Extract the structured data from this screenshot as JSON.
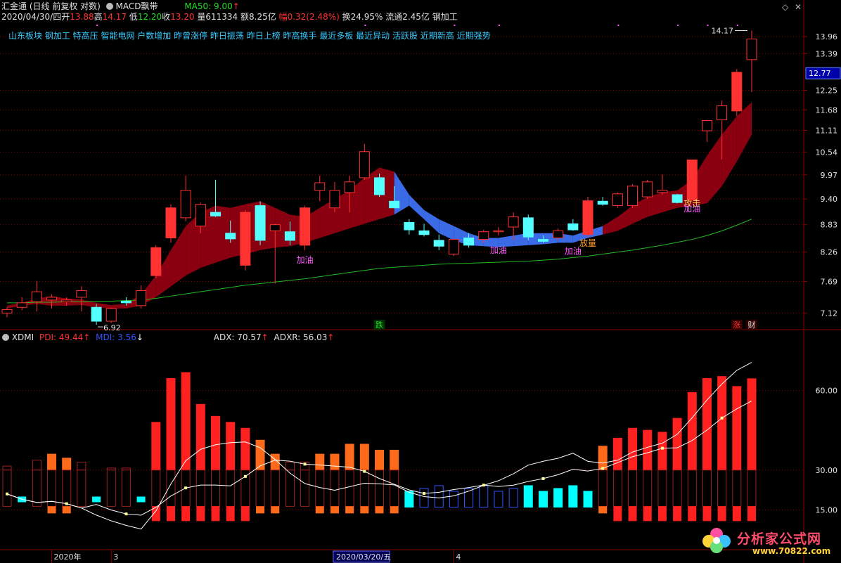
{
  "header": {
    "app": "汇金通",
    "mode": "(日线 前复权 对数)",
    "indicator": "MACD飘带",
    "ma_label": "MA50: 9.00",
    "date": "2020/04/30/四",
    "open_label": "开",
    "open": "13.88",
    "high_label": "高",
    "high": "14.17",
    "low_label": "低",
    "low": "12.20",
    "close_label": "收",
    "close": "13.20",
    "volume": "量611334",
    "amount": "额8.25亿",
    "change": "幅0.32(2.48%)",
    "turnover": "换24.95%",
    "float": "流通2.45亿",
    "industry": "钢加工"
  },
  "concepts": "山东板块 钢加工 特高压 智能电网 户数增加 昨曾涨停 昨日振荡 昨日上榜 昨高换手 最近多板 最近异动 活跃股 近期新高 近期强势",
  "sub_header": {
    "name": "XDMI",
    "pdi": "PDI: 49.44",
    "mdi": "MDI: 3.56",
    "adx": "ADX: 70.57",
    "adxr": "ADXR: 56.03"
  },
  "price_axis": [
    "13.96",
    "13.39",
    "12.25",
    "11.68",
    "11.11",
    "10.54",
    "9.97",
    "9.40",
    "8.83",
    "8.26",
    "7.69",
    "7.12"
  ],
  "current_price_tag": "12.77",
  "sub_axis": [
    "60.00",
    "30.00",
    "15.00"
  ],
  "x_axis_labels": [
    "2020年",
    "3",
    "2020/03/20/五",
    "4"
  ],
  "colors": {
    "up": "#ff3232",
    "down": "#54ffff",
    "ribbon_up": "#8b0011",
    "ribbon_down": "#3a6ae6",
    "ma": "#22bb22",
    "grid": "#8b0000",
    "magenta": "#ff55ff",
    "label": "#ff9f2a"
  },
  "chart_data": [
    {
      "type": "candlestick",
      "title": "MACD飘带",
      "scale": "log",
      "ylim": [
        6.85,
        14.5
      ],
      "high_mark": "14.17",
      "low_mark": "6.92",
      "candles": [
        {
          "o": 7.12,
          "h": 7.22,
          "l": 7.05,
          "c": 7.18
        },
        {
          "o": 7.22,
          "h": 7.4,
          "l": 7.17,
          "c": 7.3
        },
        {
          "o": 7.32,
          "h": 7.7,
          "l": 7.15,
          "c": 7.5
        },
        {
          "o": 7.35,
          "h": 7.45,
          "l": 7.2,
          "c": 7.4
        },
        {
          "o": 7.32,
          "h": 7.4,
          "l": 7.25,
          "c": 7.35
        },
        {
          "o": 7.4,
          "h": 7.6,
          "l": 7.15,
          "c": 7.52
        },
        {
          "o": 7.22,
          "h": 7.28,
          "l": 6.92,
          "c": 6.98
        },
        {
          "o": 6.98,
          "h": 7.22,
          "l": 6.95,
          "c": 7.2
        },
        {
          "o": 7.33,
          "h": 7.4,
          "l": 7.25,
          "c": 7.3
        },
        {
          "o": 7.25,
          "h": 7.62,
          "l": 7.2,
          "c": 7.52
        },
        {
          "o": 7.8,
          "h": 8.4,
          "l": 7.75,
          "c": 8.35
        },
        {
          "o": 8.55,
          "h": 9.28,
          "l": 8.45,
          "c": 9.2
        },
        {
          "o": 8.98,
          "h": 9.95,
          "l": 8.9,
          "c": 9.6
        },
        {
          "o": 8.8,
          "h": 9.32,
          "l": 8.65,
          "c": 9.28
        },
        {
          "o": 9.1,
          "h": 9.85,
          "l": 9.0,
          "c": 9.02
        },
        {
          "o": 8.65,
          "h": 8.92,
          "l": 8.45,
          "c": 8.53
        },
        {
          "o": 8.0,
          "h": 9.15,
          "l": 7.9,
          "c": 9.1
        },
        {
          "o": 9.25,
          "h": 9.35,
          "l": 8.4,
          "c": 8.5
        },
        {
          "o": 8.7,
          "h": 8.85,
          "l": 7.65,
          "c": 8.83
        },
        {
          "o": 8.68,
          "h": 8.9,
          "l": 8.4,
          "c": 8.5
        },
        {
          "o": 8.4,
          "h": 9.25,
          "l": 8.3,
          "c": 9.2
        },
        {
          "o": 9.6,
          "h": 9.95,
          "l": 9.35,
          "c": 9.78
        },
        {
          "o": 9.2,
          "h": 9.8,
          "l": 9.1,
          "c": 9.6
        },
        {
          "o": 9.55,
          "h": 9.95,
          "l": 9.1,
          "c": 9.8
        },
        {
          "o": 9.9,
          "h": 10.75,
          "l": 9.85,
          "c": 10.55
        },
        {
          "o": 9.9,
          "h": 10.0,
          "l": 9.45,
          "c": 9.5
        },
        {
          "o": 9.35,
          "h": 9.7,
          "l": 9.2,
          "c": 9.2
        },
        {
          "o": 8.88,
          "h": 8.95,
          "l": 8.62,
          "c": 8.72
        },
        {
          "o": 8.7,
          "h": 8.85,
          "l": 8.58,
          "c": 8.62
        },
        {
          "o": 8.5,
          "h": 8.62,
          "l": 8.3,
          "c": 8.38
        },
        {
          "o": 8.22,
          "h": 8.55,
          "l": 8.18,
          "c": 8.52
        },
        {
          "o": 8.55,
          "h": 8.65,
          "l": 8.35,
          "c": 8.4
        },
        {
          "o": 8.52,
          "h": 8.72,
          "l": 8.45,
          "c": 8.68
        },
        {
          "o": 8.68,
          "h": 8.78,
          "l": 8.6,
          "c": 8.7
        },
        {
          "o": 8.78,
          "h": 9.1,
          "l": 8.5,
          "c": 9.0
        },
        {
          "o": 8.98,
          "h": 9.05,
          "l": 8.5,
          "c": 8.57
        },
        {
          "o": 8.52,
          "h": 8.6,
          "l": 8.45,
          "c": 8.48
        },
        {
          "o": 8.55,
          "h": 8.75,
          "l": 8.5,
          "c": 8.7
        },
        {
          "o": 8.85,
          "h": 8.95,
          "l": 8.7,
          "c": 8.72
        },
        {
          "o": 8.62,
          "h": 9.45,
          "l": 8.55,
          "c": 9.36
        },
        {
          "o": 9.35,
          "h": 9.45,
          "l": 9.25,
          "c": 9.28
        },
        {
          "o": 9.25,
          "h": 9.55,
          "l": 9.2,
          "c": 9.52
        },
        {
          "o": 9.25,
          "h": 9.75,
          "l": 9.2,
          "c": 9.7
        },
        {
          "o": 9.45,
          "h": 9.85,
          "l": 9.4,
          "c": 9.8
        },
        {
          "o": 9.55,
          "h": 9.98,
          "l": 9.5,
          "c": 9.6
        },
        {
          "o": 9.5,
          "h": 9.52,
          "l": 9.3,
          "c": 9.32
        },
        {
          "o": 9.38,
          "h": 10.34,
          "l": 9.36,
          "c": 10.34
        },
        {
          "o": 11.1,
          "h": 11.38,
          "l": 10.8,
          "c": 11.38
        },
        {
          "o": 11.4,
          "h": 11.95,
          "l": 10.35,
          "c": 11.8
        },
        {
          "o": 11.65,
          "h": 12.9,
          "l": 11.5,
          "c": 12.8
        },
        {
          "o": 13.2,
          "h": 14.17,
          "l": 12.2,
          "c": 13.88
        }
      ],
      "ribbon": [
        {
          "a": 7.2,
          "b": 7.25
        },
        {
          "a": 7.25,
          "b": 7.3
        },
        {
          "a": 7.28,
          "b": 7.38
        },
        {
          "a": 7.25,
          "b": 7.42
        },
        {
          "a": 7.25,
          "b": 7.38
        },
        {
          "a": 7.26,
          "b": 7.36
        },
        {
          "a": 7.22,
          "b": 7.3
        },
        {
          "a": 7.2,
          "b": 7.26
        },
        {
          "a": 7.2,
          "b": 7.28
        },
        {
          "a": 7.25,
          "b": 7.45
        },
        {
          "a": 7.4,
          "b": 7.8
        },
        {
          "a": 7.6,
          "b": 8.3
        },
        {
          "a": 7.8,
          "b": 8.8
        },
        {
          "a": 7.95,
          "b": 9.1
        },
        {
          "a": 8.05,
          "b": 9.25
        },
        {
          "a": 8.15,
          "b": 9.2
        },
        {
          "a": 8.22,
          "b": 9.28
        },
        {
          "a": 8.3,
          "b": 9.35
        },
        {
          "a": 8.35,
          "b": 9.2
        },
        {
          "a": 8.38,
          "b": 9.05
        },
        {
          "a": 8.45,
          "b": 9.0
        },
        {
          "a": 8.55,
          "b": 9.2
        },
        {
          "a": 8.65,
          "b": 9.4
        },
        {
          "a": 8.75,
          "b": 9.6
        },
        {
          "a": 8.85,
          "b": 9.9
        },
        {
          "a": 8.95,
          "b": 10.15
        },
        {
          "a": 9.05,
          "b": 10.05
        },
        {
          "a": 9.25,
          "b": 9.5
        },
        {
          "a": 8.95,
          "b": 9.15
        },
        {
          "a": 8.65,
          "b": 8.95
        },
        {
          "a": 8.5,
          "b": 8.8
        },
        {
          "a": 8.4,
          "b": 8.65
        },
        {
          "a": 8.38,
          "b": 8.55
        },
        {
          "a": 8.36,
          "b": 8.55
        },
        {
          "a": 8.38,
          "b": 8.6
        },
        {
          "a": 8.4,
          "b": 8.65
        },
        {
          "a": 8.42,
          "b": 8.65
        },
        {
          "a": 8.45,
          "b": 8.65
        },
        {
          "a": 8.45,
          "b": 8.6
        },
        {
          "a": 8.55,
          "b": 8.7
        },
        {
          "a": 8.62,
          "b": 8.8
        },
        {
          "a": 8.7,
          "b": 9.0
        },
        {
          "a": 8.85,
          "b": 9.25
        },
        {
          "a": 9.0,
          "b": 9.45
        },
        {
          "a": 9.1,
          "b": 9.55
        },
        {
          "a": 9.2,
          "b": 9.6
        },
        {
          "a": 9.25,
          "b": 9.85
        },
        {
          "a": 9.3,
          "b": 10.45
        },
        {
          "a": 9.7,
          "b": 11.0
        },
        {
          "a": 10.3,
          "b": 11.5
        },
        {
          "a": 11.0,
          "b": 11.9
        }
      ],
      "ma50": [
        7.3,
        7.3,
        7.31,
        7.31,
        7.32,
        7.32,
        7.33,
        7.33,
        7.34,
        7.35,
        7.38,
        7.42,
        7.46,
        7.5,
        7.54,
        7.58,
        7.62,
        7.65,
        7.68,
        7.71,
        7.74,
        7.78,
        7.82,
        7.86,
        7.9,
        7.94,
        7.96,
        7.98,
        8.0,
        8.02,
        8.03,
        8.04,
        8.05,
        8.06,
        8.07,
        8.08,
        8.1,
        8.12,
        8.15,
        8.18,
        8.22,
        8.26,
        8.3,
        8.35,
        8.4,
        8.46,
        8.52,
        8.6,
        8.7,
        8.82,
        8.95
      ],
      "annotations": [
        {
          "i": 20,
          "price": 8.1,
          "text": "加油"
        },
        {
          "i": 33,
          "price": 8.3,
          "text": "加油"
        },
        {
          "i": 38,
          "price": 8.28,
          "text": "加油"
        },
        {
          "i": 39,
          "price": 8.44,
          "text": "放量"
        },
        {
          "i": 46,
          "price": 9.3,
          "text": "攻击"
        },
        {
          "i": 46,
          "price": 9.18,
          "text": "加油"
        }
      ],
      "bottom_marks": [
        {
          "i": 25,
          "text": "跌"
        },
        {
          "i": 49,
          "text": "涨"
        },
        {
          "i": 50,
          "text": "财"
        }
      ]
    },
    {
      "type": "bar",
      "title": "XDMI",
      "ylim": [
        0,
        80
      ],
      "series": [
        {
          "name": "PDI",
          "values": [
            20,
            17,
            23,
            25,
            26,
            25,
            22,
            24,
            23,
            23,
            42,
            60,
            62,
            48,
            44,
            41,
            37,
            34,
            30,
            27,
            25,
            28,
            27,
            30,
            29,
            27,
            28,
            18,
            17,
            15,
            14,
            13,
            12,
            12,
            11,
            10,
            11,
            11,
            9,
            12,
            27,
            30,
            33,
            33,
            31,
            37,
            47,
            52,
            52,
            46,
            49.44
          ]
        },
        {
          "name": "MDI",
          "values": [
            18,
            21,
            18,
            17,
            20,
            21,
            23,
            23,
            22,
            24,
            18,
            14,
            13,
            15,
            17,
            17,
            16,
            19,
            22,
            23,
            21,
            20,
            19,
            17,
            16,
            17,
            18,
            22,
            22,
            21,
            22,
            23,
            23,
            23,
            24,
            25,
            24,
            24,
            22,
            18,
            15,
            14,
            12,
            13,
            12,
            11,
            8,
            6,
            5,
            4,
            3.56
          ]
        }
      ]
    }
  ]
}
